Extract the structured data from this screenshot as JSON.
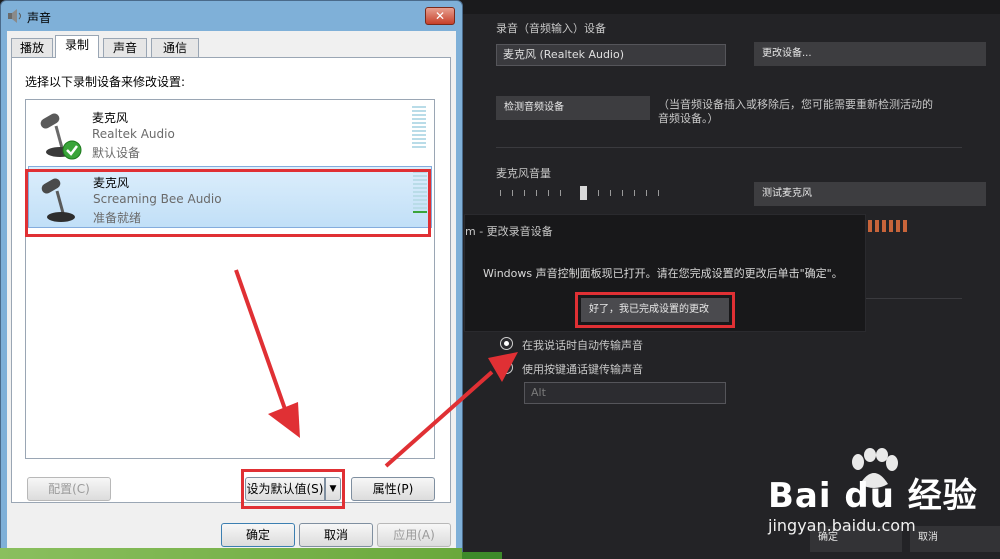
{
  "dialog": {
    "title": "声音",
    "close_label": "✕",
    "tabs": [
      {
        "label": "播放"
      },
      {
        "label": "录制"
      },
      {
        "label": "声音"
      },
      {
        "label": "通信"
      }
    ],
    "instruction": "选择以下录制设备来修改设置:",
    "devices": [
      {
        "name": "麦克风",
        "driver": "Realtek Audio",
        "status": "默认设备",
        "default": true
      },
      {
        "name": "麦克风",
        "driver": "Screaming Bee Audio",
        "status": "准备就绪",
        "default": false
      }
    ],
    "configure_label": "配置(C)",
    "set_default_label": "设为默认值(S)",
    "set_default_arrow": "▼",
    "properties_label": "属性(P)",
    "ok_label": "确定",
    "cancel_label": "取消",
    "apply_label": "应用(A)"
  },
  "settings": {
    "recording_device_label": "录音（音频输入）设备",
    "device_value": "麦克风 (Realtek Audio)",
    "change_device_label": "更改设备...",
    "detect_button_label": "检测音频设备",
    "detect_hint_line1": "（当音频设备插入或移除后，您可能需要重新检测活动的",
    "detect_hint_line2": "音频设备。）",
    "volume_label": "麦克风音量",
    "test_mic_label": "测试麦克风",
    "radio_auto_label": "在我说话时自动传输声音",
    "radio_ptt_label": "使用按键通话键传输声音",
    "hotkey_value": "Alt",
    "ok_label": "确定",
    "cancel_label": "取消"
  },
  "popup": {
    "title": "m - 更改录音设备",
    "message": "Windows 声音控制面板现已打开。请在您完成设置的更改后单击\"确定\"。",
    "done_button": "好了，我已完成设置的更改"
  },
  "watermark": {
    "brand": "Bai du 经验",
    "url": "jingyan.baidu.com"
  },
  "colors": {
    "highlight_red": "#e03034",
    "dialog_frame": "#7fb0d8",
    "selection": "#c1dff7",
    "dark_panel": "#232326"
  }
}
